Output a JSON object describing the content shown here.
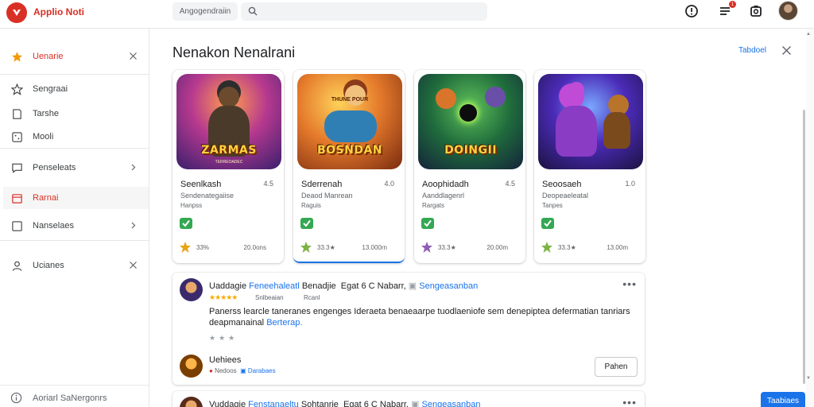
{
  "app": {
    "name": "Applio Noti",
    "brand_color": "#d93025",
    "accent_color": "#1a73e8"
  },
  "topbar": {
    "chip_label": "Angogendraiin",
    "search": {
      "value": "",
      "placeholder": ""
    },
    "notification_count": "1",
    "icons": [
      "logo-icon",
      "search-icon",
      "alert-icon",
      "menu-list-icon",
      "camera-icon",
      "avatar"
    ]
  },
  "sidebar": {
    "items": [
      {
        "label": "Uenarie",
        "icon": "star-icon",
        "active_style": "orange"
      },
      {
        "label": "Sengraai",
        "icon": "star-outline-icon"
      },
      {
        "label": "Tarshe",
        "icon": "bookmark-icon"
      },
      {
        "label": "Mooli",
        "icon": "dice-icon"
      },
      {
        "label": "Penseleats",
        "icon": "chat-icon"
      },
      {
        "label": "Rarnai",
        "icon": "calendar-icon",
        "active": true
      },
      {
        "label": "Nanselaes",
        "icon": "checkbox-icon"
      },
      {
        "label": "Ucianes",
        "icon": "user-icon"
      }
    ],
    "footer_label": "Aoriarl SaNergonrs"
  },
  "main": {
    "title": "Nenakon Nenalrani",
    "header_link": "Tabdoel"
  },
  "apps": [
    {
      "art_title": "ZARMAS",
      "art_subtitle": "TERREOADEC",
      "name": "Seenlkash",
      "rating": "4.5",
      "developer": "Sendenategaiise",
      "category": "Hanpss",
      "score": "33%",
      "downloads": "20.0ons"
    },
    {
      "art_title": "BOSNDAN",
      "art_subtitle": "THUNE POUR",
      "name": "Sderrenah",
      "rating": "4.0",
      "developer": "Deaod Manrean",
      "category": "Raguis",
      "score": "33.3★",
      "downloads": "13.000rn"
    },
    {
      "art_title": "DOINGII",
      "art_subtitle": "",
      "name": "Aoophidadh",
      "rating": "4.5",
      "developer": "Aanddlagenrl",
      "category": "Rargats",
      "score": "33.3★",
      "downloads": "20.00m"
    },
    {
      "art_title": "",
      "art_subtitle": "",
      "name": "Seoosaeh",
      "rating": "1.0",
      "developer": "Deopeaeleatal",
      "category": "Tanpes",
      "score": "33.3★",
      "downloads": "13.00m"
    }
  ],
  "reviews": [
    {
      "author": "Uaddagie",
      "author_tag": "Feneehaleatl",
      "text_1": "Benadjie",
      "text_2": "Egat 6 C Nabarr,",
      "tag": "Sengeasanban",
      "stars": "★★★★★",
      "meta_1": "Snlbeaian",
      "meta_2": "Rcanl",
      "body": "Panerss learcle taneranes engenges Ideraeta benaeaarpe tuodlaeniofe sem denepiptea defermatian tanriars deapmanainal",
      "body_link": "Berterap.",
      "mini_stars": "★★★",
      "reply_name": "Uehiees",
      "reply_meta_1": "Nedoos",
      "reply_meta_2": "Darabaes",
      "reply_button": "Pahen"
    },
    {
      "author": "Vuddagie",
      "author_tag": "Fenstanaeltu",
      "text_1": "Sohtanrie",
      "text_2": "Egat 6 C Nabarr,",
      "tag": "Sengeasanban"
    }
  ],
  "fab_label": "Taabiaes"
}
